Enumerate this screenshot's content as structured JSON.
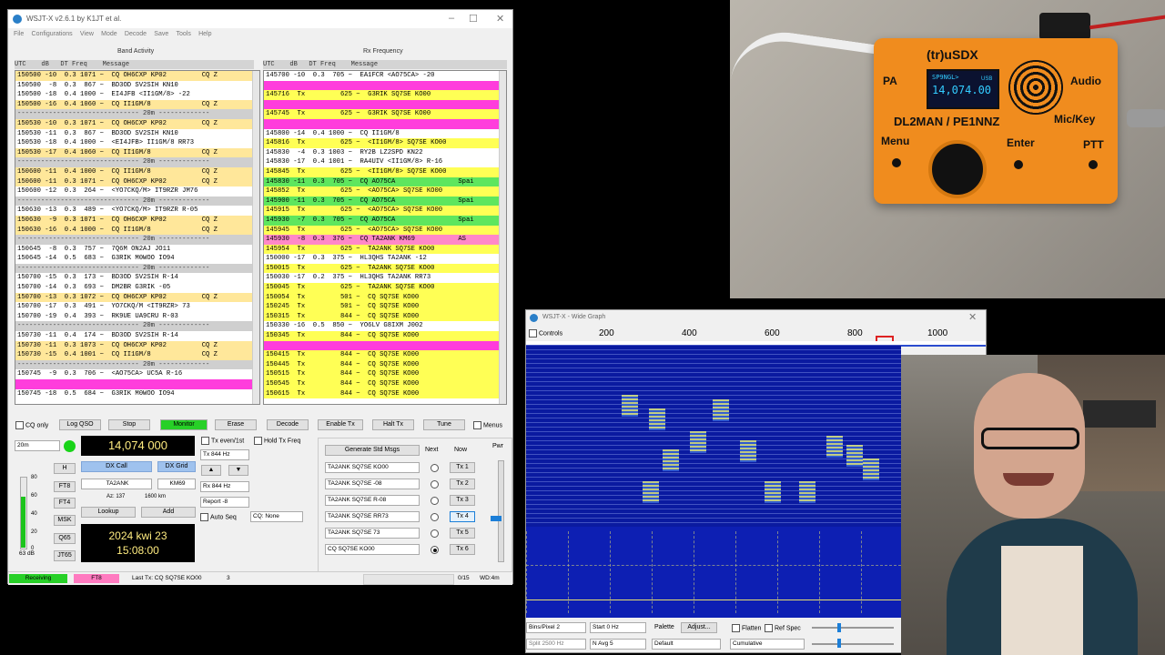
{
  "main_window": {
    "title": "WSJT-X   v2.6.1   by K1JT et al.",
    "menu": [
      "File",
      "Configurations",
      "View",
      "Mode",
      "Decode",
      "Save",
      "Tools",
      "Help"
    ],
    "band_activity_title": "Band Activity",
    "rx_frequency_title": "Rx Frequency",
    "header_left": "UTC    dB   DT Freq    Message",
    "header_right": "UTC    dB   DT Freq    Message",
    "band_rows": [
      {
        "t": "150500 -10  0.3 1071 ~  CQ OH6CXP KP02         CQ Z",
        "c": "cq"
      },
      {
        "t": "150500  -8  0.3  867 ~  BD3OD SV2SIH KN10",
        "c": "w"
      },
      {
        "t": "150500 -18  0.4 1000 ~  EI4JFB <II1GM/8> -22",
        "c": "w"
      },
      {
        "t": "150500 -16  0.4 1060 ~  CQ II1GM/8             CQ Z",
        "c": "cq"
      },
      {
        "t": "------------------------------- 20m -------------",
        "c": "sep"
      },
      {
        "t": "150530 -10  0.3 1071 ~  CQ OH6CXP KP02         CQ Z",
        "c": "cq"
      },
      {
        "t": "150530 -11  0.3  867 ~  BD3OD SV2SIH KN10",
        "c": "w"
      },
      {
        "t": "150530 -18  0.4 1000 ~  <EI4JFB> II1GM/8 RR73",
        "c": "w"
      },
      {
        "t": "150530 -17  0.4 1060 ~  CQ II1GM/8             CQ Z",
        "c": "cq"
      },
      {
        "t": "------------------------------- 20m -------------",
        "c": "sep"
      },
      {
        "t": "150600 -11  0.4 1000 ~  CQ II1GM/8             CQ Z",
        "c": "cq"
      },
      {
        "t": "150600 -11  0.3 1071 ~  CQ OH6CXP KP02         CQ Z",
        "c": "cq"
      },
      {
        "t": "150600 -12  0.3  264 ~  <YO7CKQ/M> IT9RZR JM76",
        "c": "w"
      },
      {
        "t": "------------------------------- 20m -------------",
        "c": "sep"
      },
      {
        "t": "150630 -13  0.3  489 ~  <YO7CKQ/M> IT9RZR R-05",
        "c": "w"
      },
      {
        "t": "150630  -9  0.3 1071 ~  CQ OH6CXP KP02         CQ Z",
        "c": "cq"
      },
      {
        "t": "150630 -16  0.4 1000 ~  CQ II1GM/8             CQ Z",
        "c": "cq"
      },
      {
        "t": "------------------------------- 20m -------------",
        "c": "sep"
      },
      {
        "t": "150645  -8  0.3  757 ~  7Q6M ON2AJ JO11",
        "c": "w"
      },
      {
        "t": "150645 -14  0.5  683 ~  G3RIK M0WOO IO94",
        "c": "w"
      },
      {
        "t": "------------------------------- 20m -------------",
        "c": "sep"
      },
      {
        "t": "150700 -15  0.3  173 ~  BD3OD SV2SIH R-14",
        "c": "w"
      },
      {
        "t": "150700 -14  0.3  693 ~  DM2BR G3RIK -05",
        "c": "w"
      },
      {
        "t": "150700 -13  0.3 1072 ~  CQ OH6CXP KP02         CQ Z",
        "c": "cq"
      },
      {
        "t": "150700 -17  0.3  491 ~  YO7CKQ/M <IT9RZR> 73",
        "c": "w"
      },
      {
        "t": "150700 -19  0.4  393 ~  RK9UE UA9CRU R-03",
        "c": "w"
      },
      {
        "t": "------------------------------- 20m -------------",
        "c": "sep"
      },
      {
        "t": "150730 -11  0.4  174 ~  BD3OD SV2SIH R-14",
        "c": "w"
      },
      {
        "t": "150730 -11  0.3 1073 ~  CQ OH6CXP KP02         CQ Z",
        "c": "cq"
      },
      {
        "t": "150730 -15  0.4 1001 ~  CQ II1GM/8             CQ Z",
        "c": "cq"
      },
      {
        "t": "------------------------------- 20m -------------",
        "c": "sep"
      },
      {
        "t": "150745  -9  0.3  706 ~  <AO75CA> UC5A R-16",
        "c": "w"
      },
      {
        "t": "",
        "c": "m"
      },
      {
        "t": "150745 -18  0.5  684 ~  G3RIK M0WOO IO94",
        "c": "w"
      }
    ],
    "rx_rows": [
      {
        "t": "145700 -10  0.3  705 ~  EA1FCR <AO75CA> -20",
        "c": "w"
      },
      {
        "t": "",
        "c": "m"
      },
      {
        "t": "145716  Tx         625 ~  G3RIK SQ7SE KO00",
        "c": "y"
      },
      {
        "t": "",
        "c": "m"
      },
      {
        "t": "145745  Tx         625 ~  G3RIK SQ7SE KO00",
        "c": "y"
      },
      {
        "t": "",
        "c": "m"
      },
      {
        "t": "145800 -14  0.4 1000 ~  CQ II1GM/8",
        "c": "w"
      },
      {
        "t": "145816  Tx         625 ~  <II1GM/8> SQ7SE KO00",
        "c": "y"
      },
      {
        "t": "145830  -4  0.3 1003 ~  RY2B LZ2SPD KN22",
        "c": "w"
      },
      {
        "t": "145830 -17  0.4 1001 ~  RA4UIV <II1GM/8> R-16",
        "c": "w"
      },
      {
        "t": "145845  Tx         625 ~  <II1GM/8> SQ7SE KO00",
        "c": "y"
      },
      {
        "t": "145830 -11  0.3  705 ~  CQ AO75CA                Spai",
        "c": "g"
      },
      {
        "t": "145852  Tx         625 ~  <AO75CA> SQ7SE KO00",
        "c": "y"
      },
      {
        "t": "145900 -11  0.3  705 ~  CQ AO75CA                Spai",
        "c": "g"
      },
      {
        "t": "145915  Tx         625 ~  <AO75CA> SQ7SE KO00",
        "c": "y"
      },
      {
        "t": "145930  -7  0.3  705 ~  CQ AO75CA                Spai",
        "c": "g"
      },
      {
        "t": "145945  Tx         625 ~  <AO75CA> SQ7SE KO00",
        "c": "y"
      },
      {
        "t": "145930  -8  0.3  376 ~  CQ TA2ANK KM69           AS",
        "c": "p"
      },
      {
        "t": "145954  Tx         625 ~  TA2ANK SQ7SE KO00",
        "c": "y"
      },
      {
        "t": "150000 -17  0.3  375 ~  HL3QHS TA2ANK -12",
        "c": "w"
      },
      {
        "t": "150015  Tx         625 ~  TA2ANK SQ7SE KO00",
        "c": "y"
      },
      {
        "t": "150030 -17  0.2  375 ~  HL3QHS TA2ANK RR73",
        "c": "w"
      },
      {
        "t": "150045  Tx         625 ~  TA2ANK SQ7SE KO00",
        "c": "y"
      },
      {
        "t": "150054  Tx         501 ~  CQ SQ7SE KO00",
        "c": "y"
      },
      {
        "t": "150245  Tx         501 ~  CQ SQ7SE KO00",
        "c": "y"
      },
      {
        "t": "150315  Tx         844 ~  CQ SQ7SE KO00",
        "c": "y"
      },
      {
        "t": "150330 -16  0.5  850 ~  YO6LV G8IXM J002",
        "c": "w"
      },
      {
        "t": "150345  Tx         844 ~  CQ SQ7SE KO00",
        "c": "y"
      },
      {
        "t": "",
        "c": "m"
      },
      {
        "t": "150415  Tx         844 ~  CQ SQ7SE KO00",
        "c": "y"
      },
      {
        "t": "150445  Tx         844 ~  CQ SQ7SE KO00",
        "c": "y"
      },
      {
        "t": "150515  Tx         844 ~  CQ SQ7SE KO00",
        "c": "y"
      },
      {
        "t": "150545  Tx         844 ~  CQ SQ7SE KO00",
        "c": "y"
      },
      {
        "t": "150615  Tx         844 ~  CQ SQ7SE KO00",
        "c": "y"
      }
    ],
    "buttons": {
      "cq_only": "CQ only",
      "log_qso": "Log QSO",
      "stop": "Stop",
      "monitor": "Monitor",
      "erase": "Erase",
      "decode": "Decode",
      "enable_tx": "Enable Tx",
      "halt_tx": "Halt Tx",
      "tune": "Tune",
      "menus": "Menus"
    },
    "band": "20m",
    "frequency": "14,074 000",
    "tx_even": "Tx even/1st",
    "hold_tx": "Hold Tx Freq",
    "tx_hz": "Tx  844 Hz",
    "rx_hz": "Rx  844 Hz",
    "report": "Report -8",
    "auto_seq": "Auto Seq",
    "cq_select": "CQ: None",
    "dx_call_label": "DX Call",
    "dx_grid_label": "DX Grid",
    "dx_call": "TA2ANK",
    "dx_grid": "KM69",
    "az": "Az: 137",
    "dist": "1600 km",
    "lookup": "Lookup",
    "add": "Add",
    "date": "2024 kwi 23",
    "time": "15:08:00",
    "side_buttons": [
      "H",
      "FT8",
      "FT4",
      "MSK",
      "Q65",
      "JT65"
    ],
    "meter_labels": [
      "80",
      "60",
      "40",
      "20",
      "0"
    ],
    "meter_db": "63 dB",
    "gen_std": "Generate Std Msgs",
    "next": "Next",
    "now": "Now",
    "pwr": "Pwr",
    "messages": [
      "TA2ANK SQ7SE KO00",
      "TA2ANK SQ7SE -08",
      "TA2ANK SQ7SE R-08",
      "TA2ANK SQ7SE RR73",
      "TA2ANK SQ7SE 73",
      "CQ SQ7SE KO00"
    ],
    "tx_buttons": [
      "Tx 1",
      "Tx 2",
      "Tx 3",
      "Tx 4",
      "Tx 5",
      "Tx 6"
    ],
    "status": {
      "receiving": "Receiving",
      "mode": "FT8",
      "last_tx": "Last Tx: CQ SQ7SE KO00",
      "count": "3",
      "progress": "0/15",
      "wd": "WD:4m"
    }
  },
  "radio": {
    "brand": "(tr)uSDX",
    "pa": "PA",
    "audio": "Audio",
    "callsigns": "DL2MAN / PE1NNZ",
    "mic_key": "Mic/Key",
    "menu": "Menu",
    "enter": "Enter",
    "ptt": "PTT",
    "display_line1": "SP9NGL>",
    "display_freq": "14,074.00",
    "display_mode": "USB"
  },
  "wide_graph": {
    "title": "WSJT-X - Wide Graph",
    "controls": "Controls",
    "scale": [
      "200",
      "400",
      "600",
      "800",
      "1000"
    ],
    "bins_label": "Bins/Pixel  2",
    "start_label": "Start  0 Hz",
    "palette": "Palette",
    "adjust": "Adjust...",
    "flatten": "Flatten",
    "ref_spec": "Ref Spec",
    "split": "Split  2500 Hz",
    "navg": "N Avg  5",
    "default": "Default",
    "cumulative": "Cumulative"
  },
  "colors": {
    "accent": "#27d027",
    "band_yellow": "#ffff55",
    "band_magenta": "#ff3ddc",
    "radio_orange": "#f08c1e"
  }
}
